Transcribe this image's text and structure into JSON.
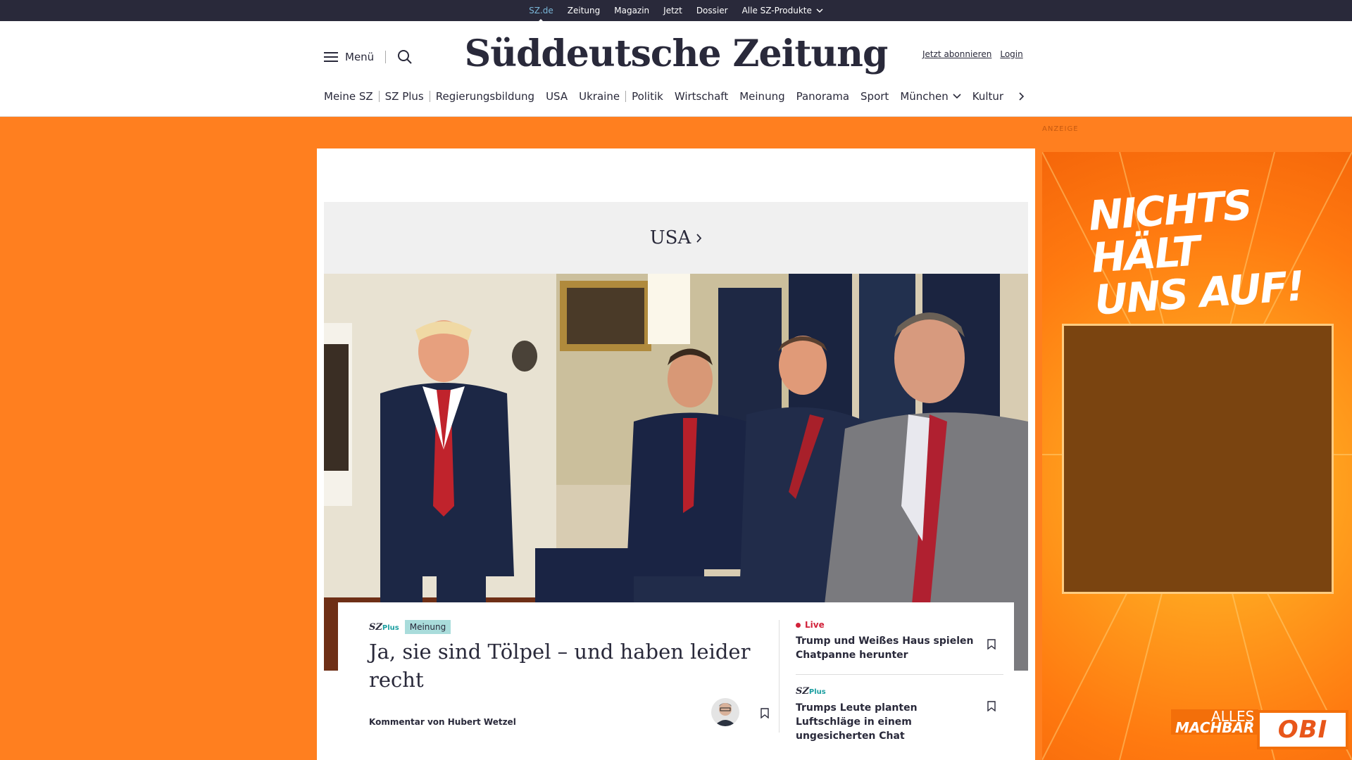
{
  "topbar": {
    "items": [
      "SZ.de",
      "Zeitung",
      "Magazin",
      "Jetzt",
      "Dossier",
      "Alle SZ-Produkte"
    ]
  },
  "header": {
    "menu_label": "Menü",
    "logo": "Süddeutsche Zeitung",
    "subscribe": "Jetzt abonnieren",
    "login": "Login"
  },
  "nav": {
    "items": [
      "Meine SZ",
      "SZ Plus",
      "Regierungsbildung",
      "USA",
      "Ukraine",
      "Politik",
      "Wirtschaft",
      "Meinung",
      "Panorama",
      "Sport",
      "München",
      "Kultur"
    ]
  },
  "ad_label": "ANZEIGE",
  "section": {
    "title": "USA"
  },
  "article": {
    "plus_logo": "SZ",
    "plus_suffix": "Plus",
    "tag": "Meinung",
    "headline": "Ja, sie sind Tölpel – und haben leider recht",
    "byline": "Kommentar von Hubert Wetzel"
  },
  "side_items": [
    {
      "label": "Live",
      "title": "Trump und Weißes Haus spielen Chatpanne herunter"
    },
    {
      "label": "Plus",
      "title": "Trumps Leute planten Luftschläge in einem ungesicherten Chat"
    }
  ],
  "ad": {
    "slogan_line1": "NICHTS HÄLT",
    "slogan_line2": "UNS AUF!",
    "alles": "ALLES",
    "machbar": "MACHBAR",
    "brand": "OBI"
  },
  "colors": {
    "brand_dark": "#29293a",
    "ad_orange": "#ff7f1f",
    "live_red": "#d2223a",
    "plus_teal": "#1a9ea0"
  }
}
